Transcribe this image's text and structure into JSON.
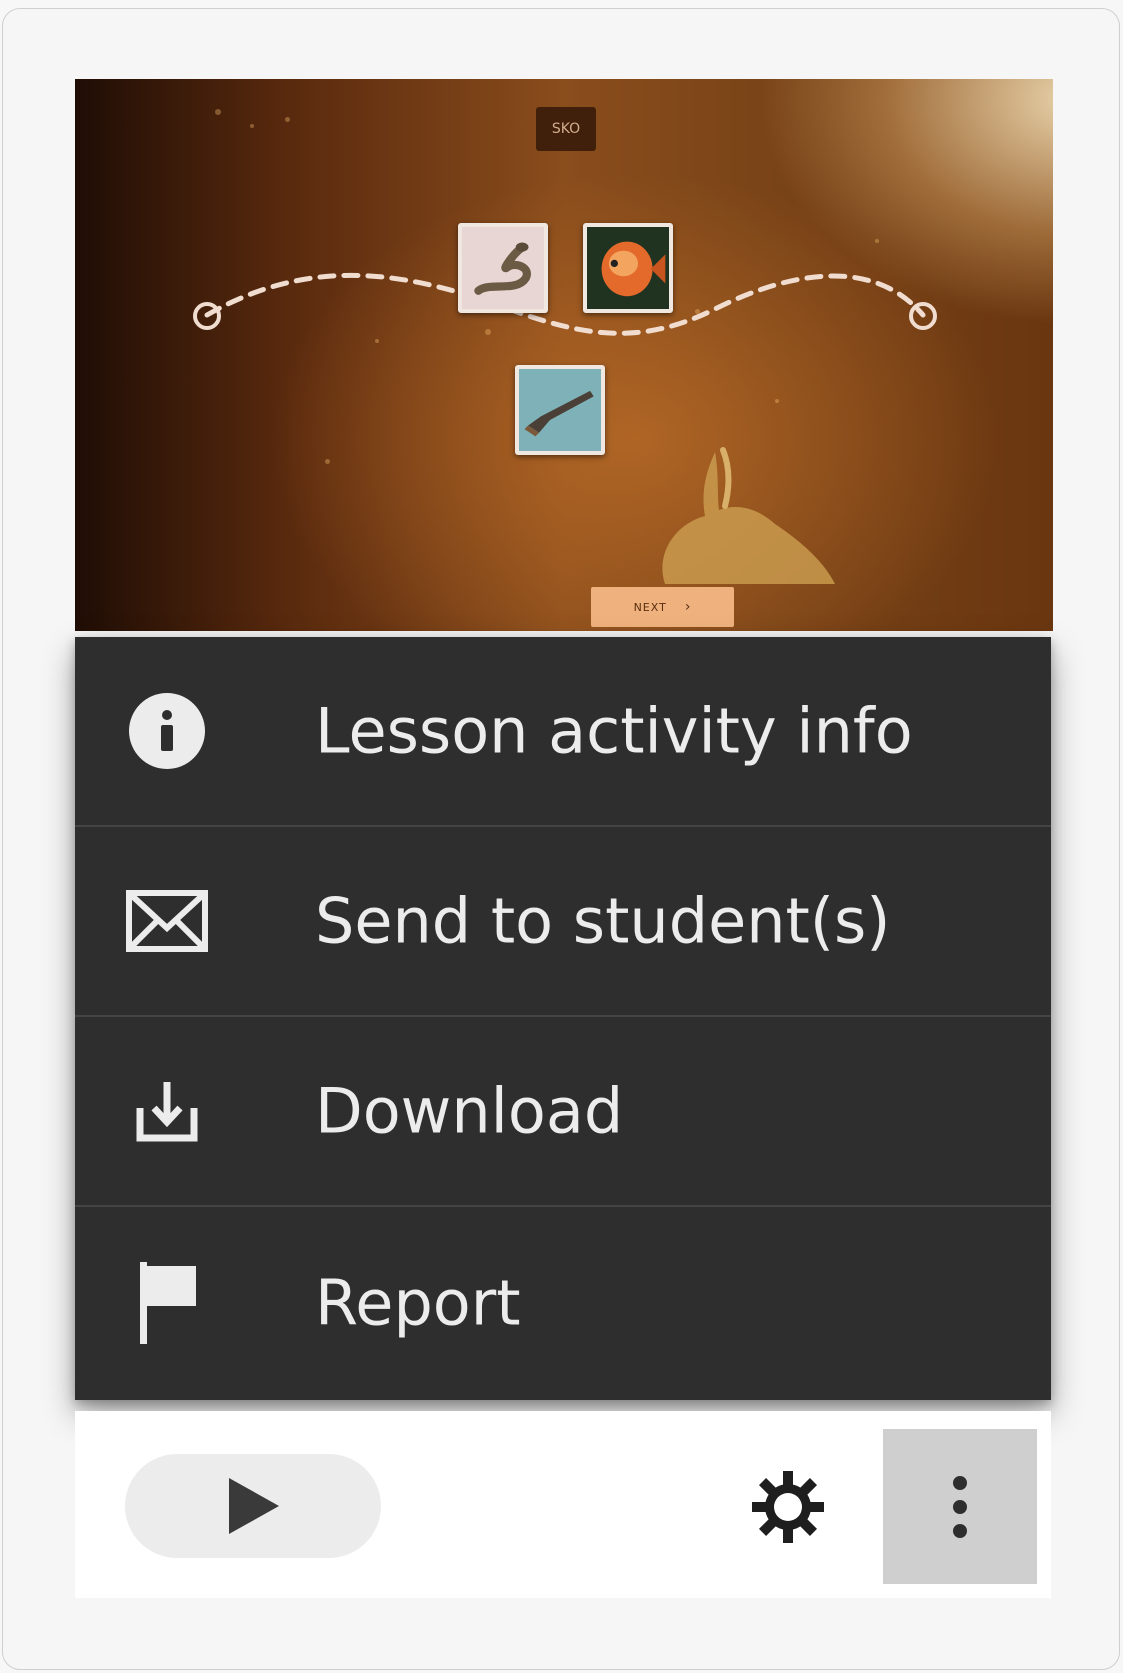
{
  "thumbnail": {
    "title_badge": "SKO",
    "next_label": "NEXT"
  },
  "menu": {
    "items": [
      {
        "id": "info",
        "label": "Lesson activity info",
        "icon": "info-circle-icon"
      },
      {
        "id": "send",
        "label": "Send to student(s)",
        "icon": "envelope-icon"
      },
      {
        "id": "download",
        "label": "Download",
        "icon": "download-icon"
      },
      {
        "id": "report",
        "label": "Report",
        "icon": "flag-icon"
      }
    ]
  },
  "toolbar": {
    "play_icon": "play-icon",
    "settings_icon": "gear-icon",
    "more_icon": "more-vertical-icon"
  },
  "colors": {
    "menu_background": "#2e2e2e",
    "menu_text": "#ececec",
    "menu_divider": "#444444",
    "toolbar_background": "#ffffff",
    "play_button_background": "#ececec",
    "more_button_background": "#cfcfcf",
    "icon_dark": "#3a3a3a"
  }
}
